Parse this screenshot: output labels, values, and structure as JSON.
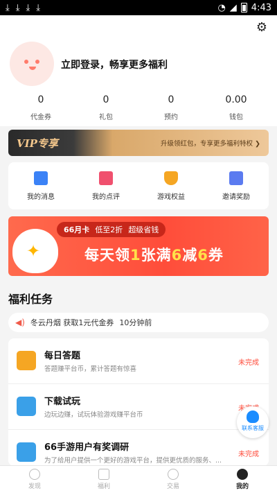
{
  "status_bar": {
    "time": "4:43",
    "left_icons": [
      "download-icon",
      "download-icon",
      "download-icon",
      "download-icon"
    ]
  },
  "profile": {
    "login_prompt": "立即登录，畅享更多福利"
  },
  "stats": [
    {
      "value": "0",
      "label": "代金券"
    },
    {
      "value": "0",
      "label": "礼包"
    },
    {
      "value": "0",
      "label": "预约"
    },
    {
      "value": "0.00",
      "label": "钱包"
    }
  ],
  "vip": {
    "tag": "VIP专享",
    "desc": "升级领红包，专享更多福利特权 ❯"
  },
  "quick_actions": [
    {
      "label": "我的消息",
      "icon": "message-icon",
      "color": "#3b82f6"
    },
    {
      "label": "我的点评",
      "icon": "review-icon",
      "color": "#f0506e"
    },
    {
      "label": "游戏权益",
      "icon": "shield-check-icon",
      "color": "#f5a623"
    },
    {
      "label": "邀请奖励",
      "icon": "invite-icon",
      "color": "#5b7bf0"
    }
  ],
  "banner": {
    "card_name": "66月卡",
    "sub1": "低至2折",
    "sub2": "超级省钱",
    "slogan_a": "每天领",
    "slogan_b": "1",
    "slogan_c": "张满",
    "slogan_d": "6",
    "slogan_e": "减",
    "slogan_f": "6",
    "slogan_g": "券"
  },
  "section": {
    "title": "福利任务"
  },
  "ticker": {
    "text": "冬云丹烟 获取1元代金券",
    "time": "10分钟前"
  },
  "tasks": [
    {
      "name": "每日答题",
      "desc": "答题赚平台币，累计答题有惊喜",
      "status": "未完成",
      "icon": "quiz-icon",
      "color": "#f5a623"
    },
    {
      "name": "下载试玩",
      "desc": "边玩边赚，试玩体验游戏赚平台币",
      "status": "未完成",
      "icon": "download-game-icon",
      "color": "#3aa0e8"
    },
    {
      "name": "66手游用户有奖调研",
      "desc": "为了给用户提供一个更好的游戏平台，提供更优质的服务、...",
      "status": "未完成",
      "icon": "survey-icon",
      "color": "#3aa0e8"
    }
  ],
  "kefu": {
    "label": "联系客服"
  },
  "tabbar": [
    {
      "label": "发现",
      "icon": "discover-icon"
    },
    {
      "label": "福利",
      "icon": "gamepad-icon"
    },
    {
      "label": "交易",
      "icon": "trade-icon"
    },
    {
      "label": "我的",
      "icon": "profile-icon",
      "active": true
    }
  ]
}
